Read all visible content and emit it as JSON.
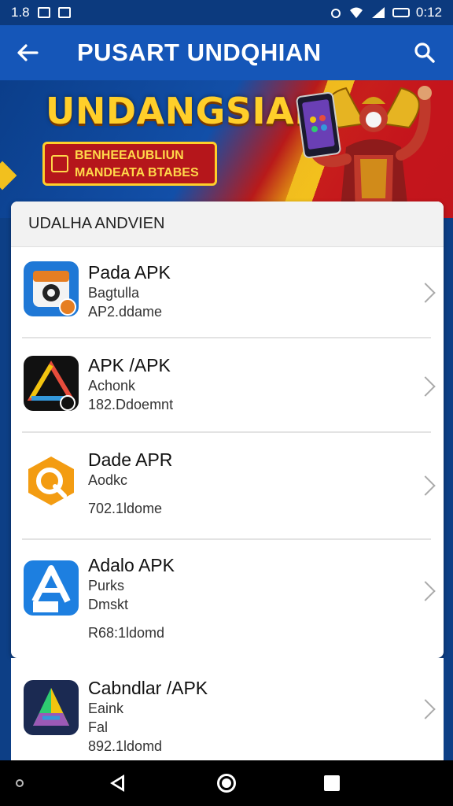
{
  "status_bar": {
    "time_left": "1.8",
    "time_right": "0:12"
  },
  "app_bar": {
    "title": "PUSART UNDQHIAN",
    "back_icon": "arrow-left-icon",
    "search_icon": "search-icon"
  },
  "banner": {
    "headline": "UNDANGSIAN",
    "badge_line1": "BENHEEAUBLIUN",
    "badge_line2": "MANDEATA BTABES"
  },
  "list": {
    "header": "UDALHA ANDVIEN",
    "items": [
      {
        "name": "Pada APK",
        "line1": "Bagtulla",
        "line2": "",
        "size": "AP2.ddame",
        "icon": "camera-app-icon",
        "color": "#1f78d6"
      },
      {
        "name": "APK /APK",
        "line1": "Achonk",
        "line2": "",
        "size": "182.Ddoemnt",
        "icon": "triangle-app-icon",
        "color": "#111111"
      },
      {
        "name": "Dade APR",
        "line1": "Aodkc",
        "line2": "",
        "size": "702.1ldome",
        "icon": "hexagon-app-icon",
        "color": "#f39c12"
      },
      {
        "name": "Adalo APK",
        "line1": "Purks",
        "line2": "Dmskt",
        "size": "R68:1ldomd",
        "icon": "a-letter-app-icon",
        "color": "#1d7fe0"
      },
      {
        "name": "Cabndlar /APK",
        "line1": "Eaink",
        "line2": "Fal",
        "size": "892.1ldomd",
        "icon": "colorful-a-app-icon",
        "color": "#1b2a52"
      }
    ]
  },
  "colors": {
    "app_bar": "#1556b8",
    "status_bar": "#0c3a7e",
    "headline": "#ffcf2a"
  }
}
